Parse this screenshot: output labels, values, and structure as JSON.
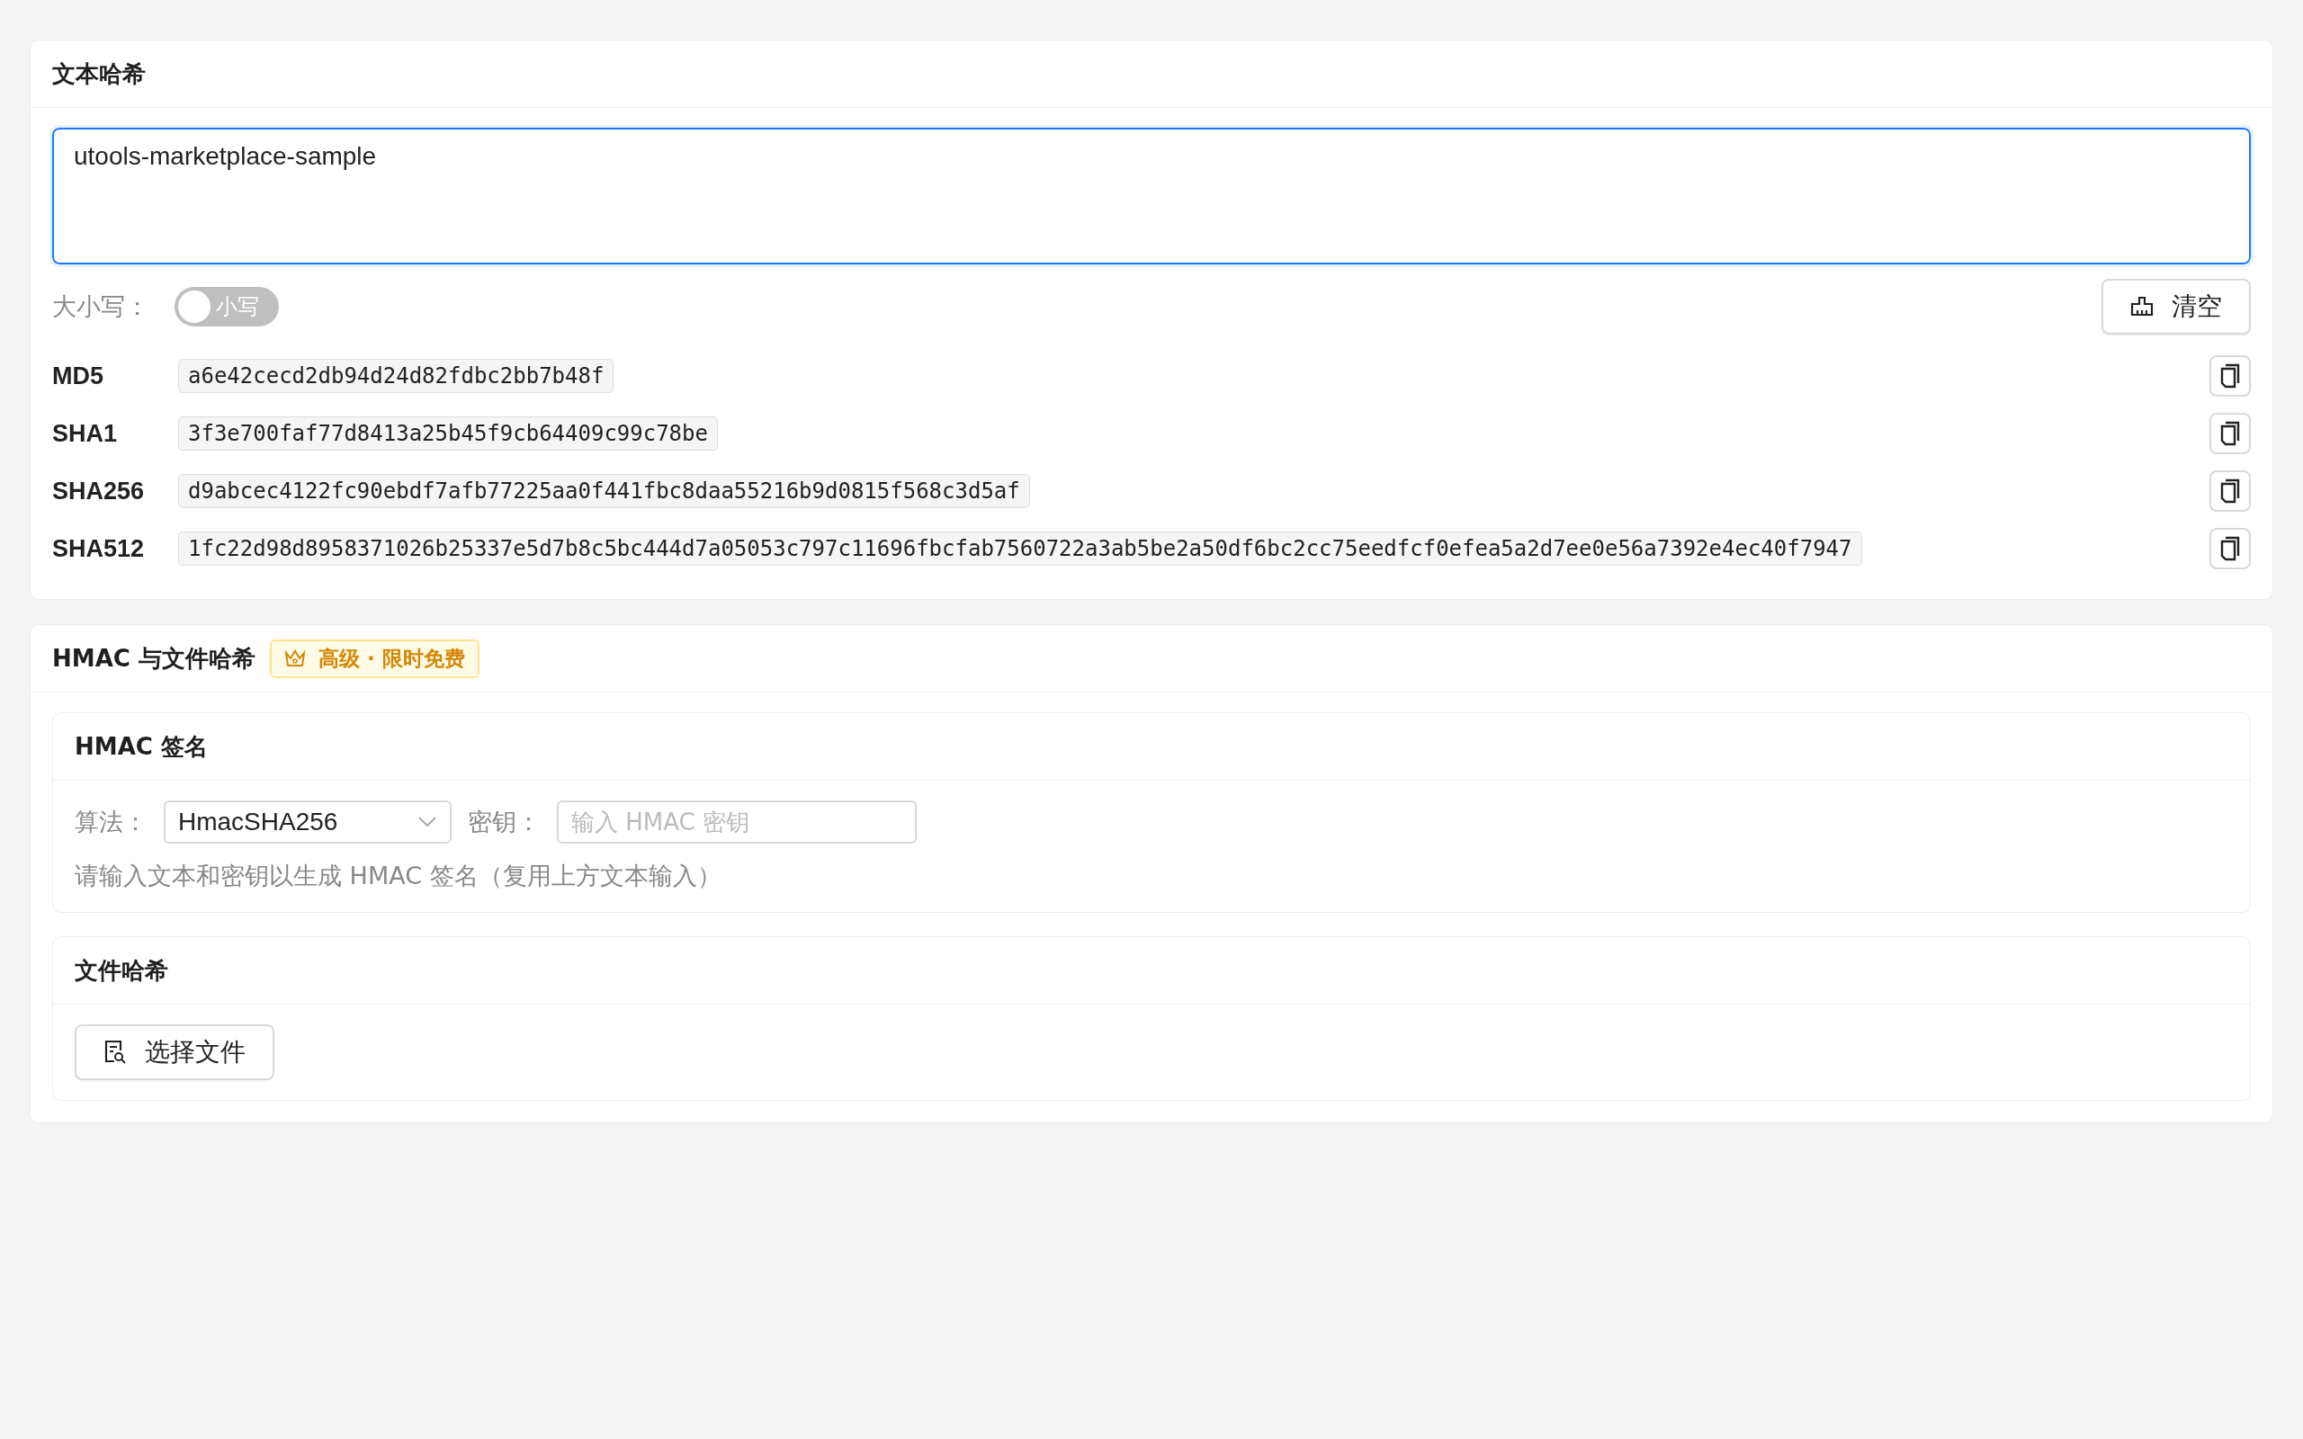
{
  "text_hash": {
    "title": "文本哈希",
    "input": {
      "value": "utools-marketplace-sample"
    },
    "case_toggle": {
      "label": "大小写：",
      "text": "小写",
      "on": false
    },
    "clear_button": "清空",
    "hashes": [
      {
        "name": "MD5",
        "value": "a6e42cecd2db94d24d82fdbc2bb7b48f"
      },
      {
        "name": "SHA1",
        "value": "3f3e700faf77d8413a25b45f9cb64409c99c78be"
      },
      {
        "name": "SHA256",
        "value": "d9abcec4122fc90ebdf7afb77225aa0f441fbc8daa55216b9d0815f568c3d5af"
      },
      {
        "name": "SHA512",
        "value": "1fc22d98d8958371026b25337e5d7b8c5bc444d7a05053c797c11696fbcfab7560722a3ab5be2a50df6bc2cc75eedfcf0efea5a2d7ee0e56a7392e4ec40f7947"
      }
    ]
  },
  "hmac_file": {
    "title": "HMAC 与文件哈希",
    "badge": "高级 · 限时免费",
    "hmac": {
      "title": "HMAC 签名",
      "algorithm_label": "算法：",
      "algorithm": "HmacSHA256",
      "key_label": "密钥：",
      "key_placeholder": "输入 HMAC 密钥",
      "hint": "请输入文本和密钥以生成 HMAC 签名（复用上方文本输入）"
    },
    "file": {
      "title": "文件哈希",
      "button": "选择文件"
    }
  }
}
